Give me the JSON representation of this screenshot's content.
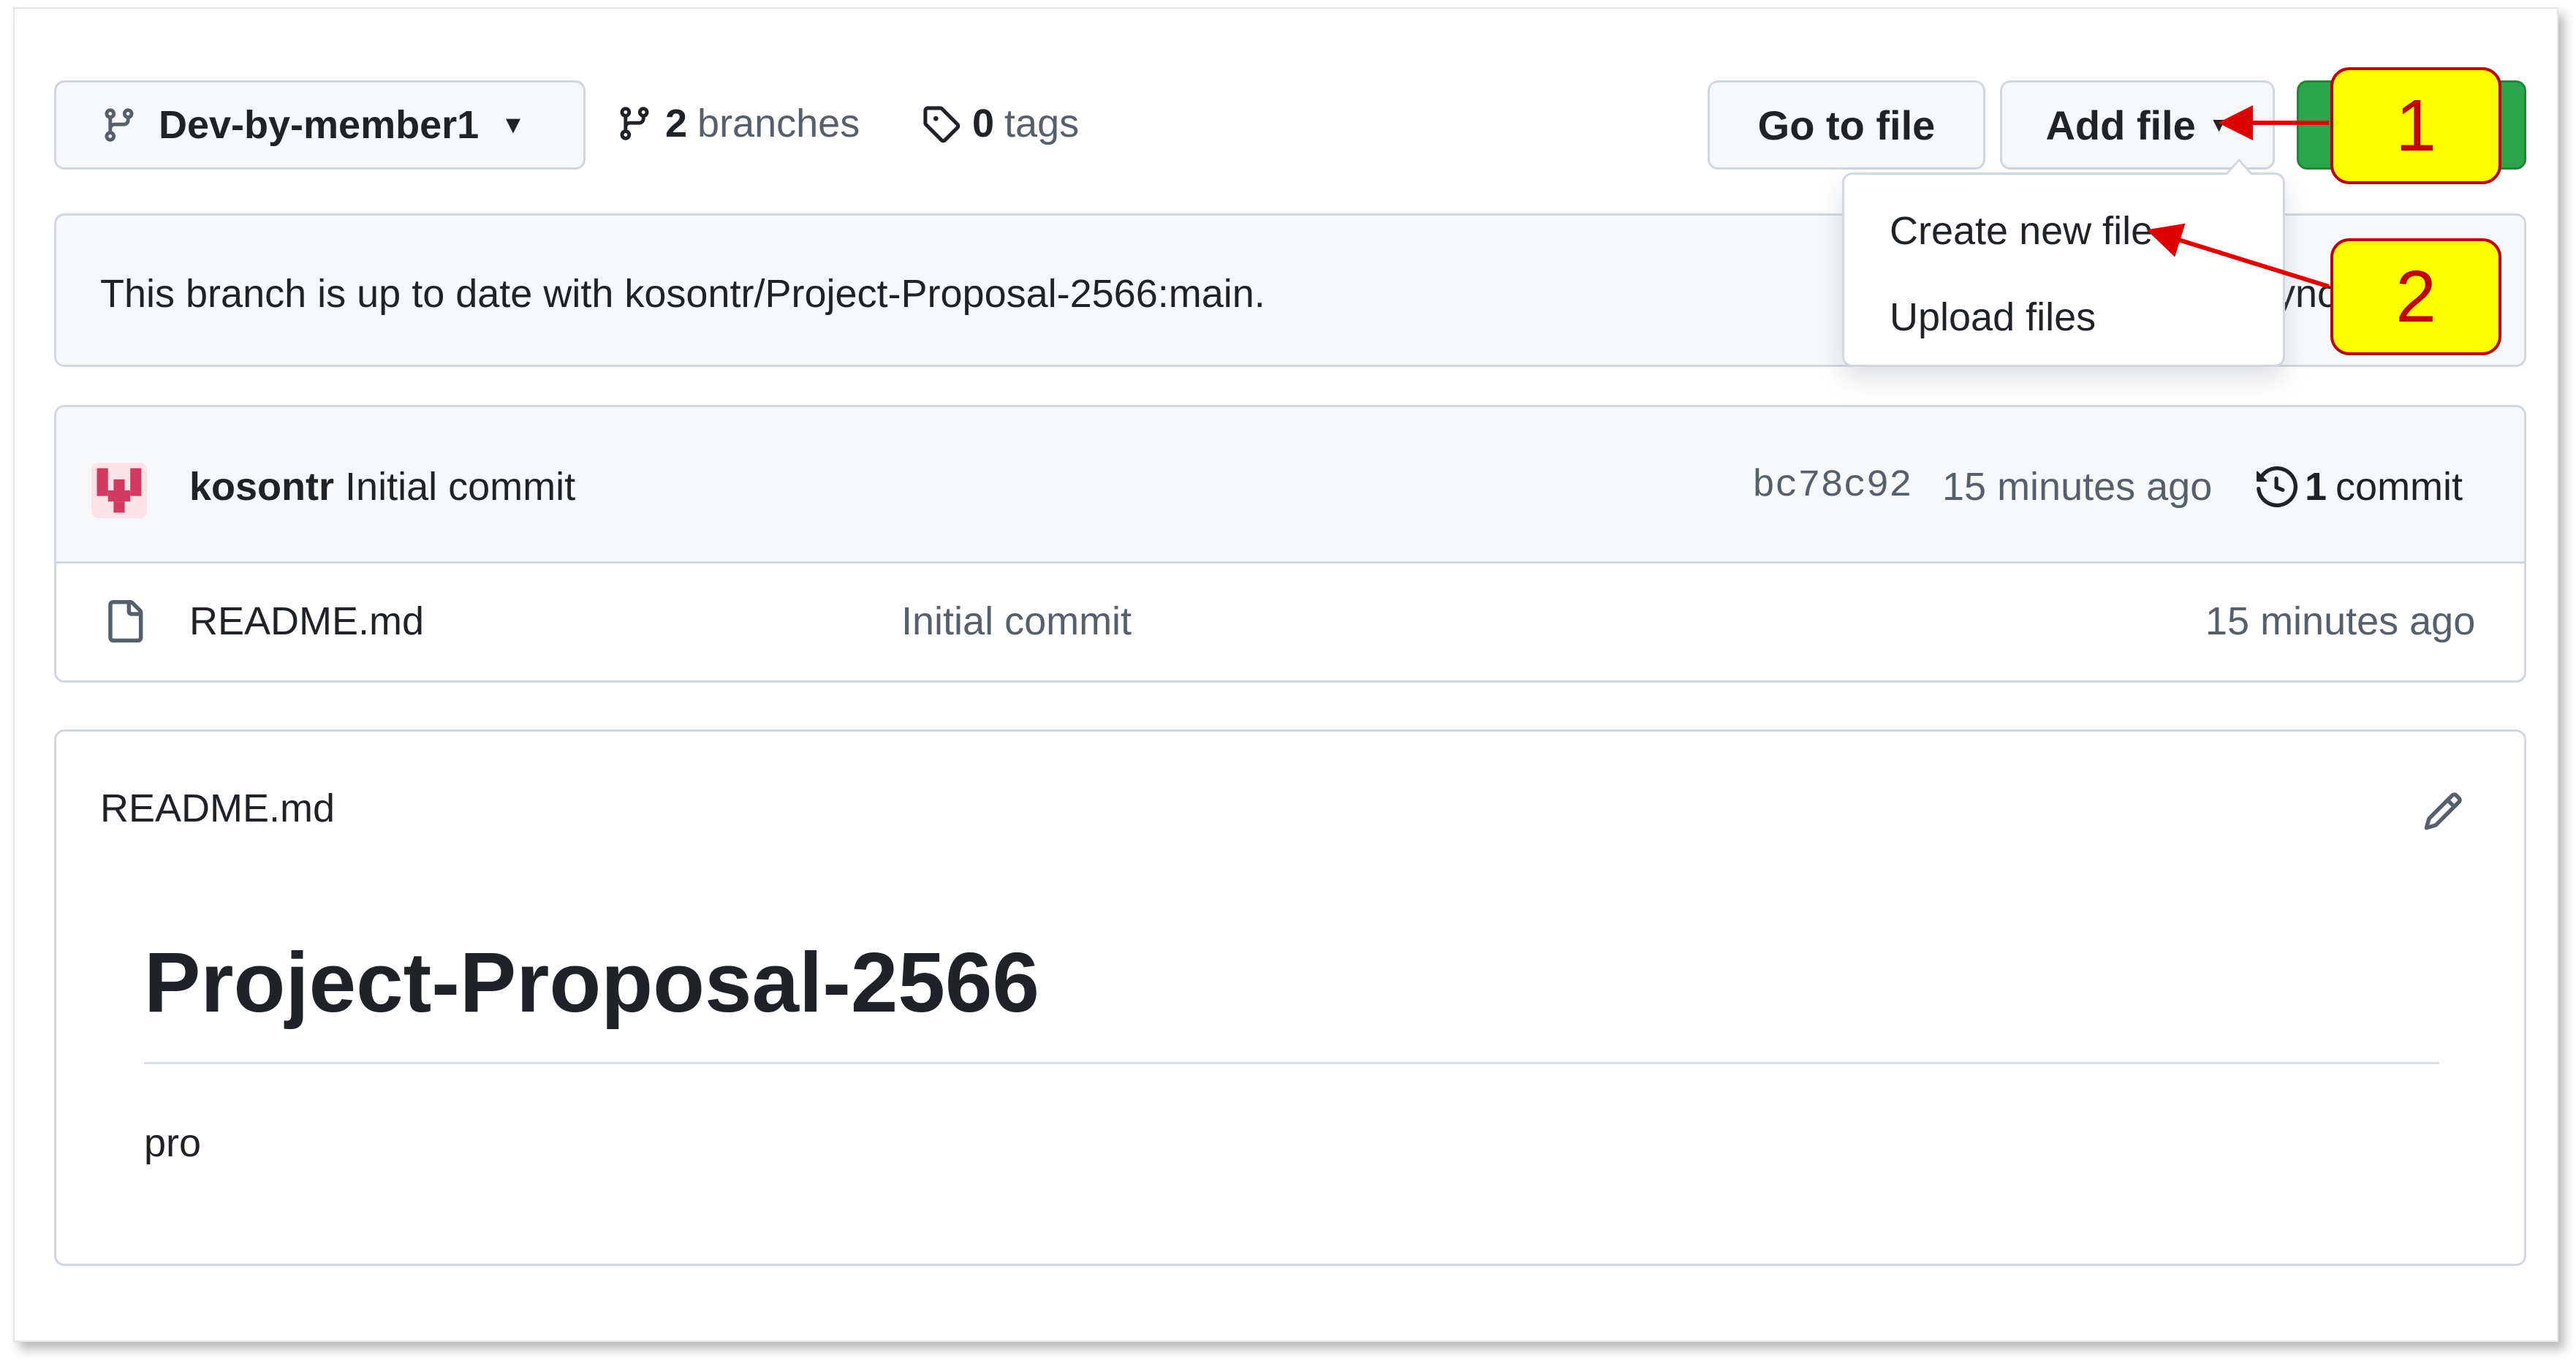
{
  "repo_bar": {
    "branch_name": "Dev-by-member1",
    "branches_count": "2",
    "branches_label": "branches",
    "tags_count": "0",
    "tags_label": "tags",
    "go_to_file_label": "Go to file",
    "add_file_label": "Add file"
  },
  "add_file_menu": {
    "items": [
      "Create new file",
      "Upload files"
    ]
  },
  "branch_status": {
    "text": "This branch is up to date with kosontr/Project-Proposal-2566:main.",
    "partial_sync_text": "ync"
  },
  "latest_commit": {
    "author": "kosontr",
    "message": "Initial commit",
    "sha": "bc78c92",
    "time": "15 minutes ago",
    "commits_count": "1",
    "commits_label": "commit"
  },
  "files": [
    {
      "name": "README.md",
      "commit_message": "Initial commit",
      "time": "15 minutes ago"
    }
  ],
  "readme": {
    "filename": "README.md",
    "heading": "Project-Proposal-2566",
    "body": "pro"
  },
  "annotations": {
    "step1": "1",
    "step2": "2",
    "color": "#c00000",
    "fill": "#ffff00"
  },
  "colors": {
    "accent_green": "#2da44e",
    "border": "#d0d7de",
    "muted_text": "#57606a"
  },
  "icons": [
    "git-branch-icon",
    "tag-icon",
    "file-icon",
    "history-icon",
    "pencil-icon",
    "avatar"
  ]
}
